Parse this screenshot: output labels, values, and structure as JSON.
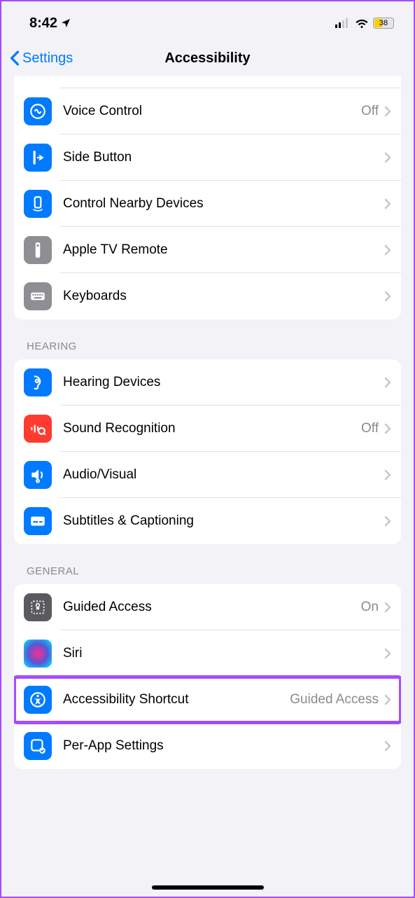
{
  "status": {
    "time": "8:42",
    "battery": "38"
  },
  "nav": {
    "back": "Settings",
    "title": "Accessibility"
  },
  "sections": {
    "physical": {
      "items": [
        {
          "label": "Voice Control",
          "detail": "Off"
        },
        {
          "label": "Side Button",
          "detail": ""
        },
        {
          "label": "Control Nearby Devices",
          "detail": ""
        },
        {
          "label": "Apple TV Remote",
          "detail": ""
        },
        {
          "label": "Keyboards",
          "detail": ""
        }
      ]
    },
    "hearing": {
      "header": "HEARING",
      "items": [
        {
          "label": "Hearing Devices",
          "detail": ""
        },
        {
          "label": "Sound Recognition",
          "detail": "Off"
        },
        {
          "label": "Audio/Visual",
          "detail": ""
        },
        {
          "label": "Subtitles & Captioning",
          "detail": ""
        }
      ]
    },
    "general": {
      "header": "GENERAL",
      "items": [
        {
          "label": "Guided Access",
          "detail": "On"
        },
        {
          "label": "Siri",
          "detail": ""
        },
        {
          "label": "Accessibility Shortcut",
          "detail": "Guided Access"
        },
        {
          "label": "Per-App Settings",
          "detail": ""
        }
      ]
    }
  }
}
